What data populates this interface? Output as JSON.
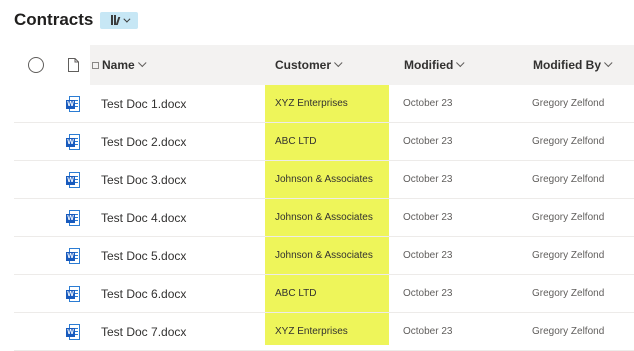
{
  "library": {
    "title": "Contracts"
  },
  "view_switcher": {
    "icon": "library-icon"
  },
  "columns": {
    "name": "Name",
    "customer": "Customer",
    "modified": "Modified",
    "modified_by": "Modified By"
  },
  "highlight_color": "#eef55a",
  "file_icon": "word-document-icon",
  "rows": [
    {
      "name": "Test Doc 1.docx",
      "customer": "XYZ Enterprises",
      "modified": "October 23",
      "modified_by": "Gregory Zelfond"
    },
    {
      "name": "Test Doc 2.docx",
      "customer": "ABC LTD",
      "modified": "October 23",
      "modified_by": "Gregory Zelfond"
    },
    {
      "name": "Test Doc 3.docx",
      "customer": "Johnson & Associates",
      "modified": "October 23",
      "modified_by": "Gregory Zelfond"
    },
    {
      "name": "Test Doc 4.docx",
      "customer": "Johnson & Associates",
      "modified": "October 23",
      "modified_by": "Gregory Zelfond"
    },
    {
      "name": "Test Doc 5.docx",
      "customer": "Johnson & Associates",
      "modified": "October 23",
      "modified_by": "Gregory Zelfond"
    },
    {
      "name": "Test Doc 6.docx",
      "customer": "ABC LTD",
      "modified": "October 23",
      "modified_by": "Gregory Zelfond"
    },
    {
      "name": "Test Doc 7.docx",
      "customer": "XYZ Enterprises",
      "modified": "October 23",
      "modified_by": "Gregory Zelfond"
    }
  ]
}
